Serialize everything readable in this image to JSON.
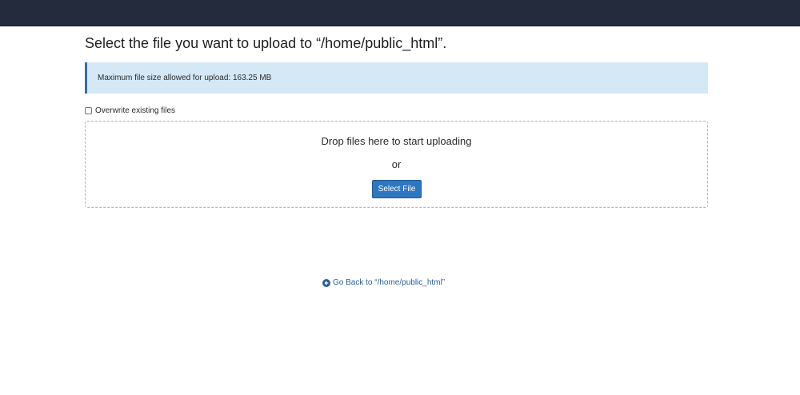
{
  "header": {
    "bar_color": "#232b3d"
  },
  "upload": {
    "title": "Select the file you want to upload to “/home/public_html”.",
    "info_text": "Maximum file size allowed for upload: 163.25 MB",
    "overwrite_label": "Overwrite existing files",
    "overwrite_checked": false,
    "drop_text": "Drop files here to start uploading",
    "or_text": "or",
    "select_button_label": "Select File"
  },
  "footer": {
    "back_link_icon": "arrow-circle-left-icon",
    "back_link_label": "Go Back to “/home/public_html”"
  },
  "colors": {
    "accent": "#2f76c0",
    "info_background": "#d4e8f6",
    "info_border": "#2f6fb0",
    "link": "#2b5f94"
  }
}
